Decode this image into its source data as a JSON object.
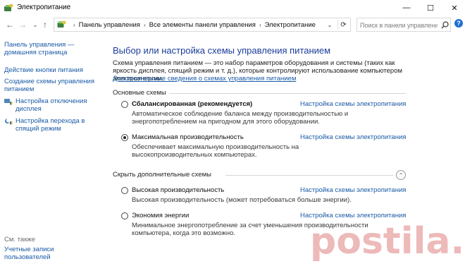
{
  "window": {
    "title": "Электропитание",
    "minimize": "—",
    "maximize": "☐",
    "close": "✕"
  },
  "nav": {
    "back": "←",
    "forward": "→",
    "recent": "⌄",
    "up": "↑",
    "breadcrumbs": [
      "Панель управления",
      "Все элементы панели управления",
      "Электропитание"
    ],
    "breadcrumb_sep": "›",
    "dropdown": "⌄",
    "refresh": "⟳",
    "search_placeholder": "Поиск в панели управления",
    "help": "?"
  },
  "sidebar": {
    "home": "Панель управления — домашняя страница",
    "items": [
      {
        "label": "Действие кнопки питания",
        "icon": null
      },
      {
        "label": "Создание схемы управления питанием",
        "icon": null
      },
      {
        "label": "Настройка отключения дисплея",
        "icon": "display-shield-icon"
      },
      {
        "label": "Настройка перехода в спящий режим",
        "icon": "moon-shield-icon"
      }
    ],
    "see_also": "См. также",
    "accounts": "Учетные записи пользователей"
  },
  "main": {
    "title": "Выбор или настройка схемы управления питанием",
    "description": "Схема управления питанием — это набор параметров оборудования и системы (таких как яркость дисплея, спящий режим и т. д.), которые контролируют использование компьютером электроэнергии.",
    "more_info_link": "Дополнительные сведения о схемах управления питанием",
    "basic_group": "Основные схемы",
    "hidden_group": "Скрыть дополнительные схемы",
    "collapse_icon": "⌃",
    "plans": [
      {
        "name": "Сбалансированная (рекомендуется)",
        "selected": false,
        "bold": true,
        "link": "Настройка схемы электропитания",
        "desc": "Автоматическое соблюдение баланса между производительностью и энергопотреблением на пригодном для этого оборудовании."
      },
      {
        "name": "Максимальная производительность",
        "selected": true,
        "bold": false,
        "link": "Настройка схемы электропитания",
        "desc": "Обеспечивает максимальную производительность на высокопроизводительных компьютерах."
      },
      {
        "name": "Высокая производительность",
        "selected": false,
        "bold": false,
        "link": "Настройка схемы электропитания",
        "desc": "Высокая производительность (может потребоваться больше энергии)."
      },
      {
        "name": "Экономия энергии",
        "selected": false,
        "bold": false,
        "link": "Настройка схемы электропитания",
        "desc": "Минимальное энергопотребление за счет уменьшения производительности компьютера, когда это возможно."
      }
    ]
  },
  "watermark": "postila.ru",
  "colors": {
    "link": "#1a5aa6",
    "title": "#1a3d99",
    "help_badge": "#1f6fd1"
  }
}
